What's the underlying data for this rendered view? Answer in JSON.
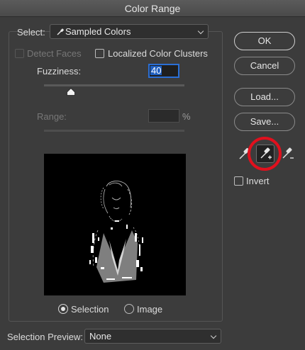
{
  "window": {
    "title": "Color Range"
  },
  "select": {
    "label": "Select:",
    "value": "Sampled Colors",
    "icon": "eyedropper-icon"
  },
  "detect_faces": {
    "label": "Detect Faces",
    "checked": false,
    "enabled": false
  },
  "localized_clusters": {
    "label": "Localized Color Clusters",
    "checked": false
  },
  "fuzziness": {
    "label": "Fuzziness:",
    "value": "40",
    "slider_fraction": 0.19
  },
  "range": {
    "label": "Range:",
    "value": "",
    "unit": "%",
    "enabled": false
  },
  "display_mode": {
    "selection_label": "Selection",
    "image_label": "Image",
    "selected": "Selection"
  },
  "selection_preview": {
    "label": "Selection Preview:",
    "value": "None"
  },
  "buttons": {
    "ok": "OK",
    "cancel": "Cancel",
    "load": "Load...",
    "save": "Save..."
  },
  "tools": {
    "sample": "eyedropper-icon",
    "add": "eyedropper-plus-icon",
    "subtract": "eyedropper-minus-icon",
    "active": "add"
  },
  "invert": {
    "label": "Invert",
    "checked": false
  },
  "annotation": {
    "color": "#e1101d"
  }
}
